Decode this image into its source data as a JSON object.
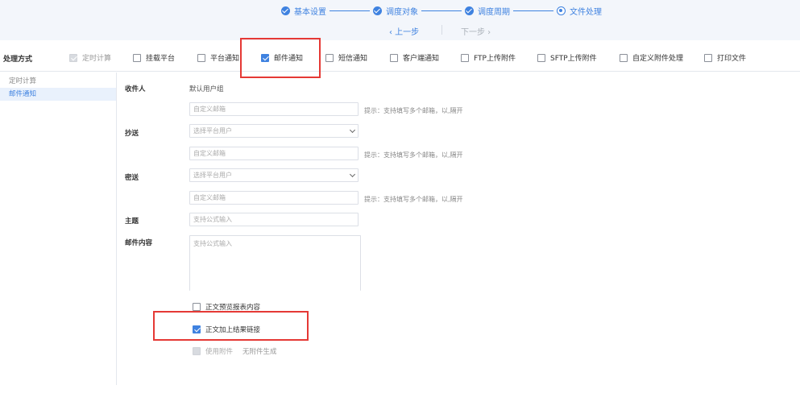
{
  "steps": [
    {
      "label": "基本设置",
      "state": "done"
    },
    {
      "label": "调度对象",
      "state": "done"
    },
    {
      "label": "调度周期",
      "state": "done"
    },
    {
      "label": "文件处理",
      "state": "current"
    }
  ],
  "nav": {
    "prev": "‹ 上一步",
    "next": "下一步 ›"
  },
  "methods": {
    "label": "处理方式",
    "options": [
      {
        "label": "定时计算",
        "checked": true,
        "disabled": true
      },
      {
        "label": "挂载平台",
        "checked": false,
        "disabled": false
      },
      {
        "label": "平台通知",
        "checked": false,
        "disabled": false
      },
      {
        "label": "邮件通知",
        "checked": true,
        "disabled": false
      },
      {
        "label": "短信通知",
        "checked": false,
        "disabled": false
      },
      {
        "label": "客户端通知",
        "checked": false,
        "disabled": false
      },
      {
        "label": "FTP上传附件",
        "checked": false,
        "disabled": false
      },
      {
        "label": "SFTP上传附件",
        "checked": false,
        "disabled": false
      },
      {
        "label": "自定义附件处理",
        "checked": false,
        "disabled": false
      },
      {
        "label": "打印文件",
        "checked": false,
        "disabled": false
      }
    ]
  },
  "sidebar": {
    "items": [
      {
        "label": "定时计算",
        "active": false
      },
      {
        "label": "邮件通知",
        "active": true
      }
    ]
  },
  "form": {
    "recipient": {
      "label": "收件人",
      "default_group": "默认用户组",
      "custom_placeholder": "自定义邮箱",
      "hint": "提示：支持填写多个邮箱，以,隔开"
    },
    "cc": {
      "label": "抄送",
      "select_placeholder": "选择平台用户",
      "custom_placeholder": "自定义邮箱",
      "hint": "提示：支持填写多个邮箱，以,隔开"
    },
    "bcc": {
      "label": "密送",
      "select_placeholder": "选择平台用户",
      "custom_placeholder": "自定义邮箱",
      "hint": "提示：支持填写多个邮箱，以,隔开"
    },
    "subject": {
      "label": "主题",
      "placeholder": "支持公式输入"
    },
    "content": {
      "label": "邮件内容",
      "placeholder": "支持公式输入"
    },
    "options": {
      "preview": {
        "label": "正文预览报表内容",
        "checked": false
      },
      "link": {
        "label": "正文加上结果链接",
        "checked": true
      },
      "attachment": {
        "label": "使用附件",
        "extra": "无附件生成",
        "checked": false,
        "disabled": true
      }
    }
  },
  "colors": {
    "accent": "#3f82e0",
    "highlight": "#e53935"
  }
}
